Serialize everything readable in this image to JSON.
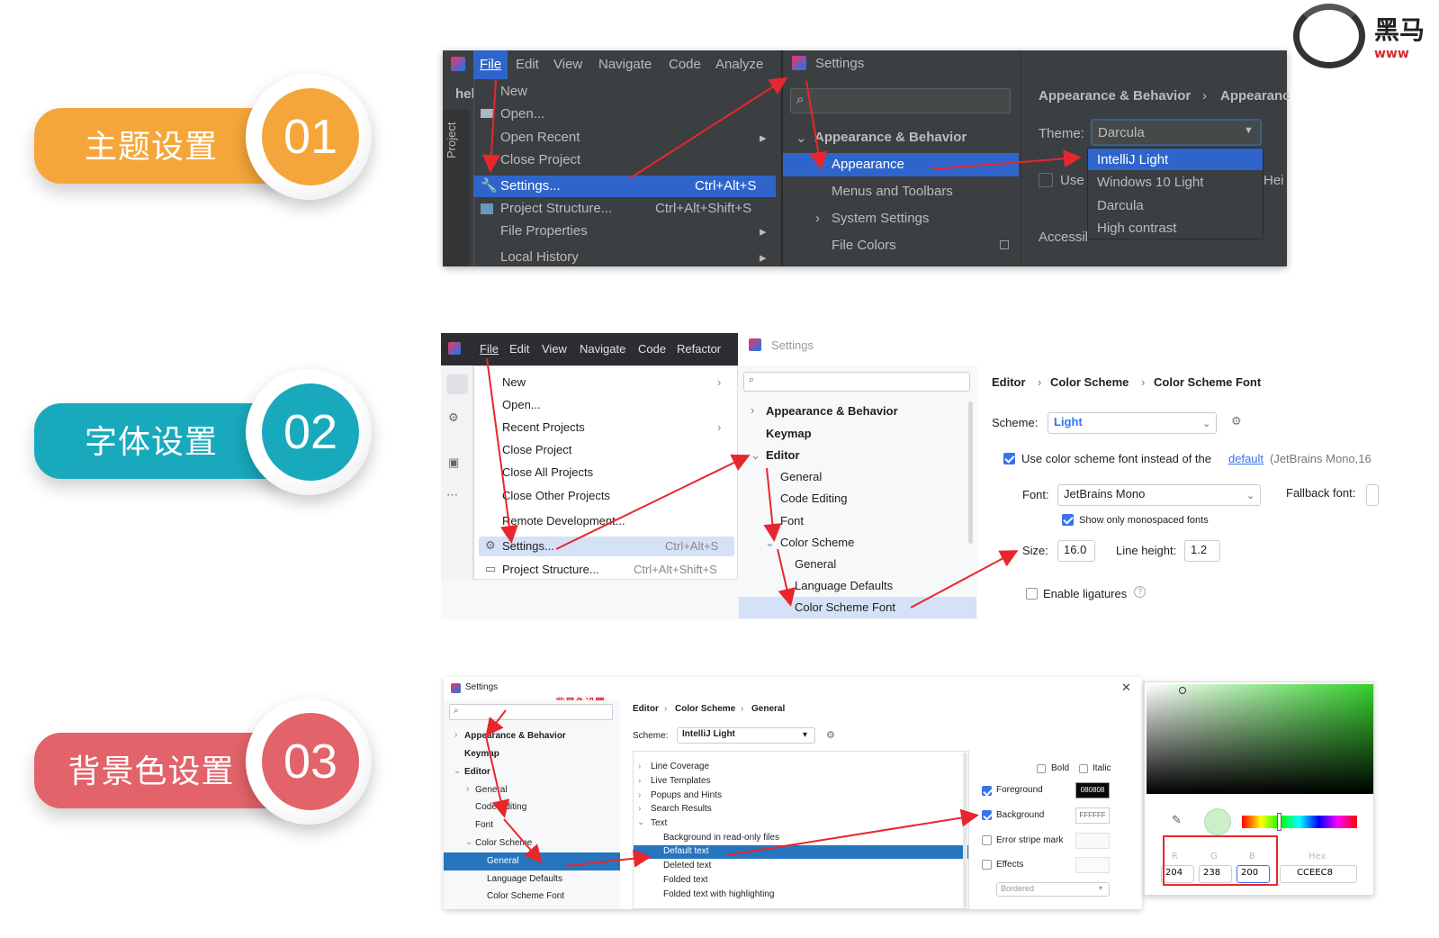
{
  "badges": [
    {
      "label": "主题设置",
      "number": "01",
      "pill_color": "#f5a63a",
      "circle_color": "#f5a63a"
    },
    {
      "label": "字体设置",
      "number": "02",
      "pill_color": "#19a9bd",
      "circle_color": "#19a9bd"
    },
    {
      "label": "背景色设置",
      "number": "03",
      "pill_color": "#e3636a",
      "circle_color": "#e3636a"
    }
  ],
  "logo": {
    "text": "黑马",
    "sub": "www"
  },
  "panel1": {
    "menubar": [
      "File",
      "Edit",
      "View",
      "Navigate",
      "Code",
      "Analyze"
    ],
    "side_text": "hel",
    "project_tab": "Project",
    "menu": [
      {
        "label": "New",
        "shortcut": ""
      },
      {
        "label": "Open...",
        "shortcut": ""
      },
      {
        "label": "Open Recent",
        "shortcut": ""
      },
      {
        "label": "Close Project",
        "shortcut": ""
      },
      {
        "label": "Settings...",
        "shortcut": "Ctrl+Alt+S"
      },
      {
        "label": "Project Structure...",
        "shortcut": "Ctrl+Alt+Shift+S"
      },
      {
        "label": "File Properties",
        "shortcut": ""
      },
      {
        "label": "Local History",
        "shortcut": ""
      }
    ],
    "settings_title": "Settings",
    "tree": [
      "Appearance & Behavior",
      "Appearance",
      "Menus and Toolbars",
      "System Settings",
      "File Colors"
    ],
    "breadcrumb": [
      "Appearance & Behavior",
      "Appearanc"
    ],
    "theme_label": "Theme:",
    "theme_value": "Darcula",
    "use_label": "Use",
    "hei": "Hei",
    "accessib": "Accessil",
    "theme_options": [
      "IntelliJ Light",
      "Windows 10 Light",
      "Darcula",
      "High contrast"
    ]
  },
  "panel2": {
    "menubar": [
      "File",
      "Edit",
      "View",
      "Navigate",
      "Code",
      "Refactor"
    ],
    "menu": [
      {
        "label": "New",
        "shortcut": ""
      },
      {
        "label": "Open...",
        "shortcut": ""
      },
      {
        "label": "Recent Projects",
        "shortcut": ""
      },
      {
        "label": "Close Project",
        "shortcut": ""
      },
      {
        "label": "Close All Projects",
        "shortcut": ""
      },
      {
        "label": "Close Other Projects",
        "shortcut": ""
      },
      {
        "label": "Remote Development...",
        "shortcut": ""
      },
      {
        "label": "Settings...",
        "shortcut": "Ctrl+Alt+S"
      },
      {
        "label": "Project Structure...",
        "shortcut": "Ctrl+Alt+Shift+S"
      }
    ],
    "settings_title": "Settings",
    "tree": [
      "Appearance & Behavior",
      "Keymap",
      "Editor",
      "General",
      "Code Editing",
      "Font",
      "Color Scheme",
      "General",
      "Language Defaults",
      "Color Scheme Font"
    ],
    "breadcrumb": [
      "Editor",
      "Color Scheme",
      "Color Scheme Font"
    ],
    "scheme_label": "Scheme:",
    "scheme_value": "Light",
    "use_font_label": "Use color scheme font instead of the",
    "default_link": "default",
    "default_suffix": "(JetBrains Mono,16",
    "font_label": "Font:",
    "font_value": "JetBrains Mono",
    "fallback_label": "Fallback font:",
    "mono_label": "Show only monospaced fonts",
    "size_label": "Size:",
    "size_value": "16.0",
    "lh_label": "Line height:",
    "lh_value": "1.2",
    "ligatures_label": "Enable ligatures"
  },
  "panel3": {
    "settings_title": "Settings",
    "annotation": "背景色设置",
    "tree": [
      "Appearance & Behavior",
      "Keymap",
      "Editor",
      "General",
      "Code Editing",
      "Font",
      "Color Scheme",
      "General",
      "Language Defaults",
      "Color Scheme Font"
    ],
    "breadcrumb": [
      "Editor",
      "Color Scheme",
      "General"
    ],
    "scheme_label": "Scheme:",
    "scheme_value": "IntelliJ Light",
    "list": [
      "Line Coverage",
      "Live Templates",
      "Popups and Hints",
      "Search Results",
      "Text",
      "Background in read-only files",
      "Default text",
      "Deleted text",
      "Folded text",
      "Folded text with highlighting"
    ],
    "bold": "Bold",
    "italic": "Italic",
    "foreground": "Foreground",
    "fg_hex": "080808",
    "background": "Background",
    "bg_hex": "FFFFFF",
    "error_stripe": "Error stripe mark",
    "effects": "Effects",
    "bordered": "Bordered",
    "r_label": "R",
    "g_label": "G",
    "b_label": "B",
    "hex_label": "Hex",
    "r": "204",
    "g": "238",
    "b": "200",
    "hex": "CCEEC8"
  }
}
